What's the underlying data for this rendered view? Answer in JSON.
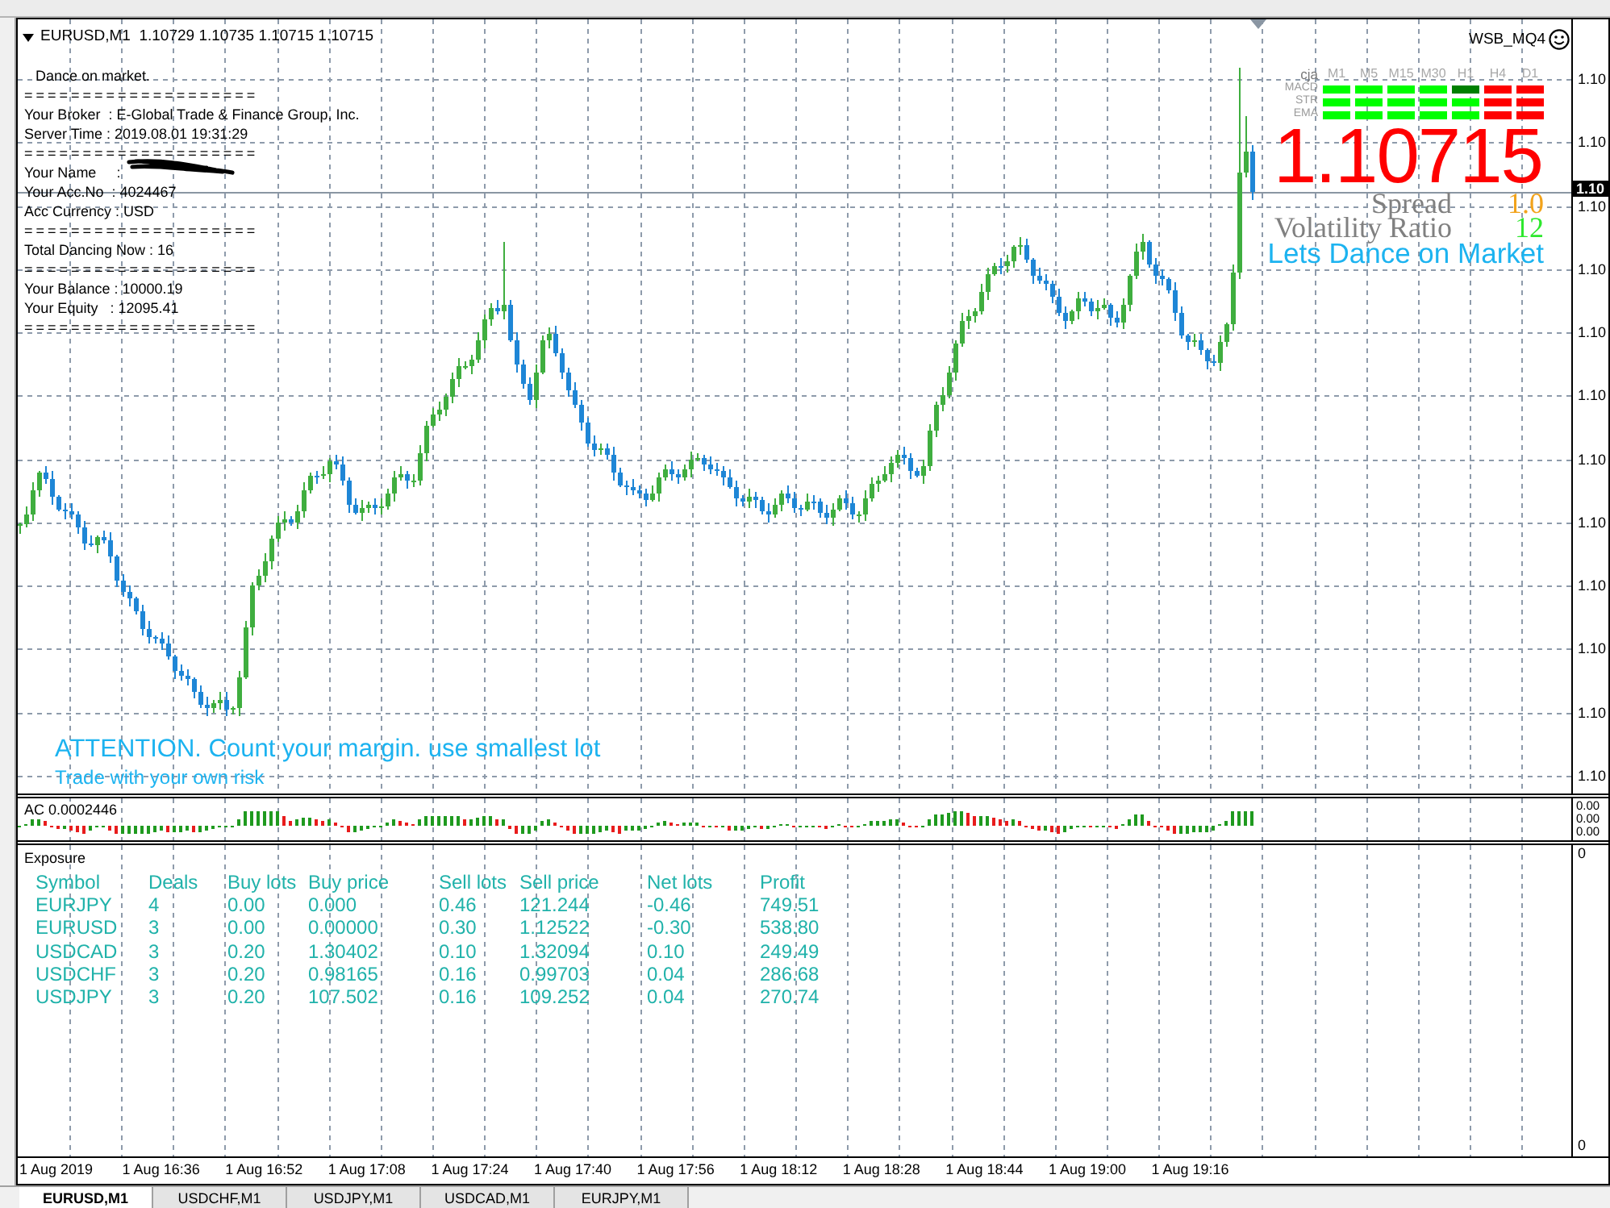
{
  "chart": {
    "title": "EURUSD,M1  1.10729 1.10735 1.10715 1.10715",
    "expert": "WSB_MQ4"
  },
  "info_panel": {
    "lines": [
      {
        "kind": "heading",
        "text": "Dance on market.",
        "redacted": false
      },
      {
        "kind": "rule",
        "text": "====================",
        "redacted": false
      },
      {
        "kind": "line",
        "text": "Your Broker  : E-Global Trade & Finance Group, Inc.",
        "redacted": false
      },
      {
        "kind": "line",
        "text": "Server Time : 2019.08.01 19:31:29",
        "redacted": false
      },
      {
        "kind": "rule",
        "text": "====================",
        "redacted": false
      },
      {
        "kind": "line",
        "text": "Your Name     :",
        "redacted": true
      },
      {
        "kind": "line",
        "text": "Your Acc.No  : 4024467",
        "redacted": false
      },
      {
        "kind": "line",
        "text": "Acc Currency : USD",
        "redacted": false
      },
      {
        "kind": "rule",
        "text": "====================",
        "redacted": false
      },
      {
        "kind": "line",
        "text": "Total Dancing Now : 16",
        "redacted": false
      },
      {
        "kind": "rule",
        "text": "====================",
        "redacted": false
      },
      {
        "kind": "line",
        "text": "Your Balance : 10000.19",
        "redacted": false
      },
      {
        "kind": "line",
        "text": "Your Equity   : 12095.41",
        "redacted": false
      },
      {
        "kind": "rule",
        "text": "====================",
        "redacted": false
      }
    ]
  },
  "signals": {
    "corner": "cja",
    "timeframes": [
      "M1",
      "M5",
      "M15",
      "M30",
      "H1",
      "H4",
      "D1"
    ],
    "rows": [
      {
        "label": "MACD",
        "cells": [
          {
            "color": "#00ff00"
          },
          {
            "color": "#00ff00"
          },
          {
            "color": "#00ff00"
          },
          {
            "color": "#00ff00"
          },
          {
            "color": "#008000"
          },
          {
            "color": "#ff0000"
          },
          {
            "color": "#ff0000"
          }
        ]
      },
      {
        "label": "STR",
        "cells": [
          {
            "color": "#00ff00"
          },
          {
            "color": "#00ff00"
          },
          {
            "color": "#00ff00"
          },
          {
            "color": "#00ff00"
          },
          {
            "color": "#00ff00"
          },
          {
            "color": "#ff0000"
          },
          {
            "color": "#ff0000"
          }
        ]
      },
      {
        "label": "EMA",
        "cells": [
          {
            "color": "#00ff00"
          },
          {
            "color": "#00ff00"
          },
          {
            "color": "#00ff00"
          },
          {
            "color": "#00ff00"
          },
          {
            "color": "#00ff00"
          },
          {
            "color": "#ff0000"
          },
          {
            "color": "#ff0000"
          }
        ]
      }
    ]
  },
  "quote": {
    "price": "1.10715",
    "spread_label": "Spread",
    "spread_value": "1.0",
    "volatility_label": "Volatility Ratio",
    "volatility_value": "12",
    "slogan": "Lets Dance on Market"
  },
  "notices": [
    {
      "kind": "headline",
      "text": "ATTENTION. Count your margin. use smallest lot"
    },
    {
      "kind": "note",
      "text": "Trade with your own risk"
    }
  ],
  "price_axis": {
    "labels": [
      "1.10",
      "1.10",
      "1.10",
      "1.10",
      "1.10",
      "1.10",
      "1.10",
      "1.10",
      "1.10",
      "1.10",
      "1.10",
      "1.10"
    ],
    "current": "1.10"
  },
  "ac_indicator": {
    "title": "AC 0.0002446",
    "axis_labels": [
      "0.00",
      "0.00",
      "0.00"
    ]
  },
  "exposure": {
    "title": "Exposure",
    "columns": [
      "Symbol",
      "Deals",
      "Buy lots",
      "Buy price",
      "Sell lots",
      "Sell price",
      "Net lots",
      "Profit"
    ],
    "rows": [
      [
        "EURJPY",
        "4",
        "0.00",
        "0.000",
        "0.46",
        "121.244",
        "-0.46",
        "749.51"
      ],
      [
        "EURUSD",
        "3",
        "0.00",
        "0.00000",
        "0.30",
        "1.12522",
        "-0.30",
        "538.80"
      ],
      [
        "USDCAD",
        "3",
        "0.20",
        "1.30402",
        "0.10",
        "1.32094",
        "0.10",
        "249.49"
      ],
      [
        "USDCHF",
        "3",
        "0.20",
        "0.98165",
        "0.16",
        "0.99703",
        "0.04",
        "286.68"
      ],
      [
        "USDJPY",
        "3",
        "0.20",
        "107.502",
        "0.16",
        "109.252",
        "0.04",
        "270.74"
      ]
    ],
    "axis_labels": [
      "0",
      "0"
    ]
  },
  "time_axis": {
    "labels": [
      "1 Aug 2019",
      "1 Aug 16:36",
      "1 Aug 16:52",
      "1 Aug 17:08",
      "1 Aug 17:24",
      "1 Aug 17:40",
      "1 Aug 17:56",
      "1 Aug 18:12",
      "1 Aug 18:28",
      "1 Aug 18:44",
      "1 Aug 19:00",
      "1 Aug 19:16"
    ]
  },
  "tabs": [
    {
      "label": "EURUSD,M1",
      "selected": true
    },
    {
      "label": "USDCHF,M1",
      "selected": false
    },
    {
      "label": "USDJPY,M1",
      "selected": false
    },
    {
      "label": "USDCAD,M1",
      "selected": false
    },
    {
      "label": "EURJPY,M1",
      "selected": false
    }
  ]
}
